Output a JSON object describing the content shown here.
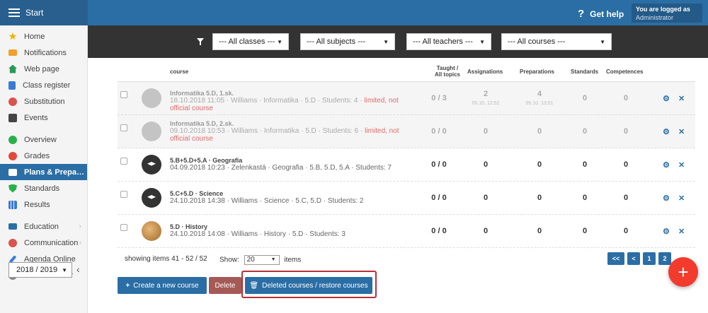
{
  "topbar": {
    "start_label": "Start",
    "help_label": "Get help",
    "user_line1": "You are logged as",
    "user_line2": "Administrator"
  },
  "sidebar": {
    "items": [
      {
        "label": "Home",
        "icon": "star-icon",
        "color": "#f0b400"
      },
      {
        "label": "Notifications",
        "icon": "envelope-icon",
        "color": "#f0a030"
      },
      {
        "label": "Web page",
        "icon": "home-icon",
        "color": "#2a9a5a"
      },
      {
        "label": "Class register",
        "icon": "book-icon",
        "color": "#3a7bd5"
      },
      {
        "label": "Substitution",
        "icon": "person-icon",
        "color": "#d9534f"
      },
      {
        "label": "Events",
        "icon": "calendar-icon",
        "color": "#444444"
      },
      {
        "label": "Overview",
        "icon": "check-circle-icon",
        "color": "#2ab04a"
      },
      {
        "label": "Grades",
        "icon": "grade-icon",
        "color": "#e04a3a"
      },
      {
        "label": "Plans & Prepa…",
        "icon": "briefcase-icon",
        "color": "#ffffff"
      },
      {
        "label": "Standards",
        "icon": "shield-icon",
        "color": "#2ab04a"
      },
      {
        "label": "Results",
        "icon": "bar-chart-icon",
        "color": "#3a7bd5"
      },
      {
        "label": "Education",
        "icon": "education-icon",
        "color": "#2b6ea5"
      },
      {
        "label": "Communication",
        "icon": "chat-icon",
        "color": "#d9534f"
      },
      {
        "label": "Agenda Online",
        "icon": "pencil-icon",
        "color": "#3a7bd5"
      },
      {
        "label": "Control center",
        "icon": "gear-icon",
        "color": "#888888"
      }
    ],
    "year": "2018 / 2019"
  },
  "filters": {
    "classes": "--- All classes ---",
    "subjects": "--- All subjects ---",
    "teachers": "--- All teachers ---",
    "courses": "--- All courses ---"
  },
  "table": {
    "headers": {
      "course": "course",
      "taught": "Taught /",
      "taught2": "All topics",
      "assignations": "Assignations",
      "preparations": "Preparations",
      "standards": "Standards",
      "competences": "Competences"
    },
    "rows": [
      {
        "name": "Informatika 5.D, 1.sk.",
        "desc": "18.10.2018 11:05 · Williams · Informatika · 5.D · Students: 4 · ",
        "warn": "limited, not official course",
        "taught": "0 / 3",
        "assignations": "2",
        "assign_date": "05.10. 12:52",
        "preparations": "4",
        "prep_date": "05.10. 13:51",
        "standards": "0",
        "competences": "0"
      },
      {
        "name": "Informatika 5.D, 2.sk.",
        "desc": "09.10.2018 10:53 · Williams · Informatika · 5.D · Students: 6 · ",
        "warn": "limited, not official course",
        "taught": "0 / 0",
        "assignations": "0",
        "preparations": "0",
        "standards": "0",
        "competences": "0"
      },
      {
        "name": "5.B+5.D+5.A · Geografia",
        "desc": "04.09.2018 10:23 · Zelenkastá · Geografia · 5.B, 5.D, 5.A · Students: 7",
        "taught": "0 / 0",
        "assignations": "0",
        "preparations": "0",
        "standards": "0",
        "competences": "0"
      },
      {
        "name": "5.C+5.D · Science",
        "desc": "24.10.2018 14:38 · Williams · Science · 5.C, 5.D · Students: 2",
        "taught": "0 / 0",
        "assignations": "0",
        "preparations": "0",
        "standards": "0",
        "competences": "0"
      },
      {
        "name": "5.D · History",
        "desc": "24.10.2018 14:08 · Williams · History · 5.D · Students: 3",
        "taught": "0 / 0",
        "assignations": "0",
        "preparations": "0",
        "standards": "0",
        "competences": "0"
      }
    ]
  },
  "footer": {
    "showing": "showing items 41 - 52 / 52",
    "show_label": "Show:",
    "page_size": "20",
    "items_label": "items",
    "pages": [
      "<<",
      "<",
      "1",
      "2"
    ],
    "fab": "+",
    "create_btn": "Create a new course",
    "delete_btn": "Delete",
    "deleted_btn": "Deleted courses / restore courses"
  }
}
